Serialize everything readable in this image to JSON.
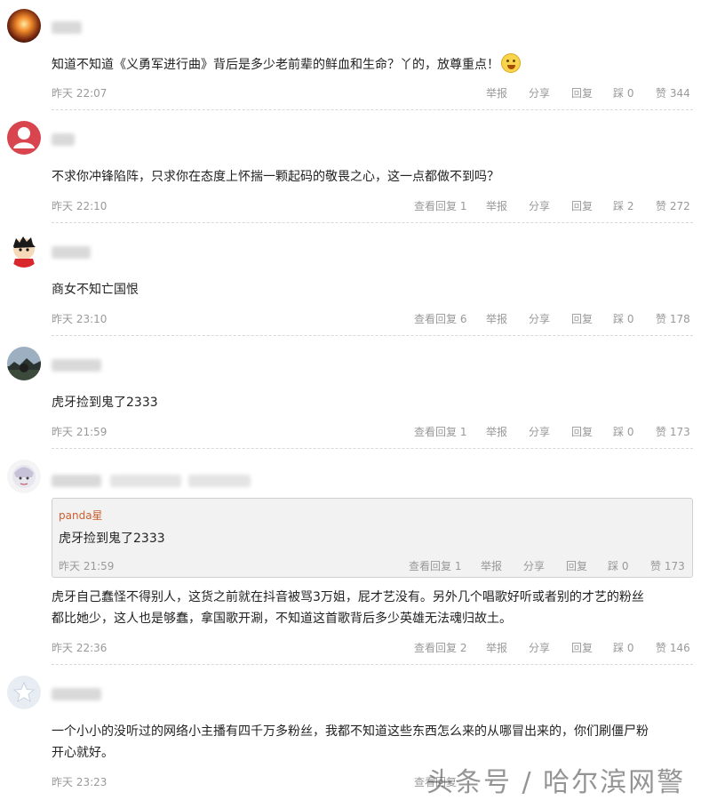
{
  "comments": [
    {
      "time": "昨天 22:07",
      "text": "知道不知道《义勇军进行曲》背后是多少老前辈的鲜血和生命？丫的，放尊重点！",
      "view_replies": "",
      "report": "举报",
      "share": "分享",
      "reply": "回复",
      "dislike": "踩 0",
      "like": "赞 344"
    },
    {
      "time": "昨天 22:10",
      "text": "不求你冲锋陷阵，只求你在态度上怀揣一颗起码的敬畏之心，这一点都做不到吗？",
      "view_replies": "查看回复 1",
      "report": "举报",
      "share": "分享",
      "reply": "回复",
      "dislike": "踩 2",
      "like": "赞 272"
    },
    {
      "time": "昨天 23:10",
      "text": "商女不知亡国恨",
      "view_replies": "查看回复 6",
      "report": "举报",
      "share": "分享",
      "reply": "回复",
      "dislike": "踩 0",
      "like": "赞 178"
    },
    {
      "time": "昨天 21:59",
      "text": "虎牙捡到鬼了2333",
      "view_replies": "查看回复 1",
      "report": "举报",
      "share": "分享",
      "reply": "回复",
      "dislike": "踩 0",
      "like": "赞 173"
    },
    {
      "time": "昨天 22:36",
      "text_line1": "虎牙自己蠢怪不得别人，这货之前就在抖音被骂3万姐，屁才艺没有。另外几个唱歌好听或者别的才艺的粉丝",
      "text_line2": "都比她少，这人也是够蠢，拿国歌开涮，不知道这首歌背后多少英雄无法魂归故土。",
      "view_replies": "查看回复 2",
      "report": "举报",
      "share": "分享",
      "reply": "回复",
      "dislike": "踩 0",
      "like": "赞 146",
      "quote": {
        "name": "panda星",
        "text": "虎牙捡到鬼了2333",
        "time": "昨天 21:59",
        "view_replies": "查看回复 1",
        "report": "举报",
        "share": "分享",
        "reply": "回复",
        "dislike": "踩 0",
        "like": "赞 173"
      }
    },
    {
      "time": "昨天 23:23",
      "text_line1": "一个小小的没听过的网络小主播有四千万多粉丝，我都不知道这些东西怎么来的从哪冒出来的，你们刷僵尸粉",
      "text_line2": "开心就好。",
      "view_replies": "查看回复",
      "report": "举报",
      "share": "分享",
      "reply": "回复",
      "dislike": "",
      "like": ""
    }
  ],
  "watermark": "头条号 / 哈尔滨网警",
  "colors": {
    "accent_name": "#c9602e",
    "meta_gray": "#999999"
  }
}
